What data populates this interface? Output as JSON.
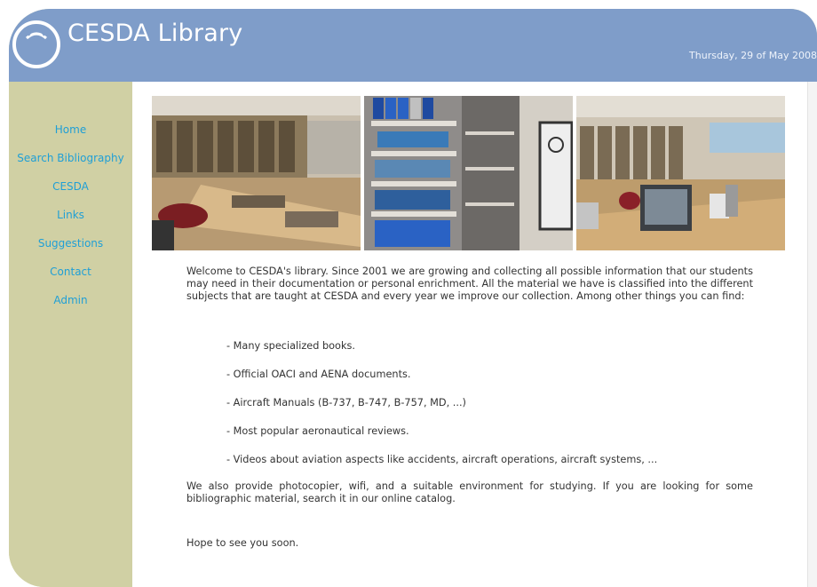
{
  "site": {
    "title": "CESDA Library",
    "date": "Thursday, 29 of May 2008"
  },
  "nav": [
    {
      "label": "Home"
    },
    {
      "label": "Search Bibliography"
    },
    {
      "label": "CESDA"
    },
    {
      "label": "Links"
    },
    {
      "label": "Suggestions"
    },
    {
      "label": "Contact"
    },
    {
      "label": "Admin"
    }
  ],
  "content": {
    "intro": "Welcome to CESDA's library. Since 2001 we are growing and collecting all possible information that our students may need in their documentation or personal enrichment. All the material we have is classified into the different subjects that are taught at CESDA and every year we improve our collection. Among other things you can find:",
    "items": [
      "- Many specialized books.",
      "- Official OACI and AENA documents.",
      "- Aircraft Manuals (B-737, B-747, B-757, MD, ...)",
      "- Most popular aeronautical reviews.",
      "- Videos about aviation aspects like accidents, aircraft operations, aircraft systems, ..."
    ],
    "services": "We also provide photocopier, wifi, and a suitable environment for studying. If you are looking for some bibliographic material, search it in our online catalog.",
    "closing": "Hope to see you soon."
  },
  "colors": {
    "header": "#7f9dc9",
    "sidebar": "#d0d0a4",
    "link": "#1f9fd6"
  }
}
